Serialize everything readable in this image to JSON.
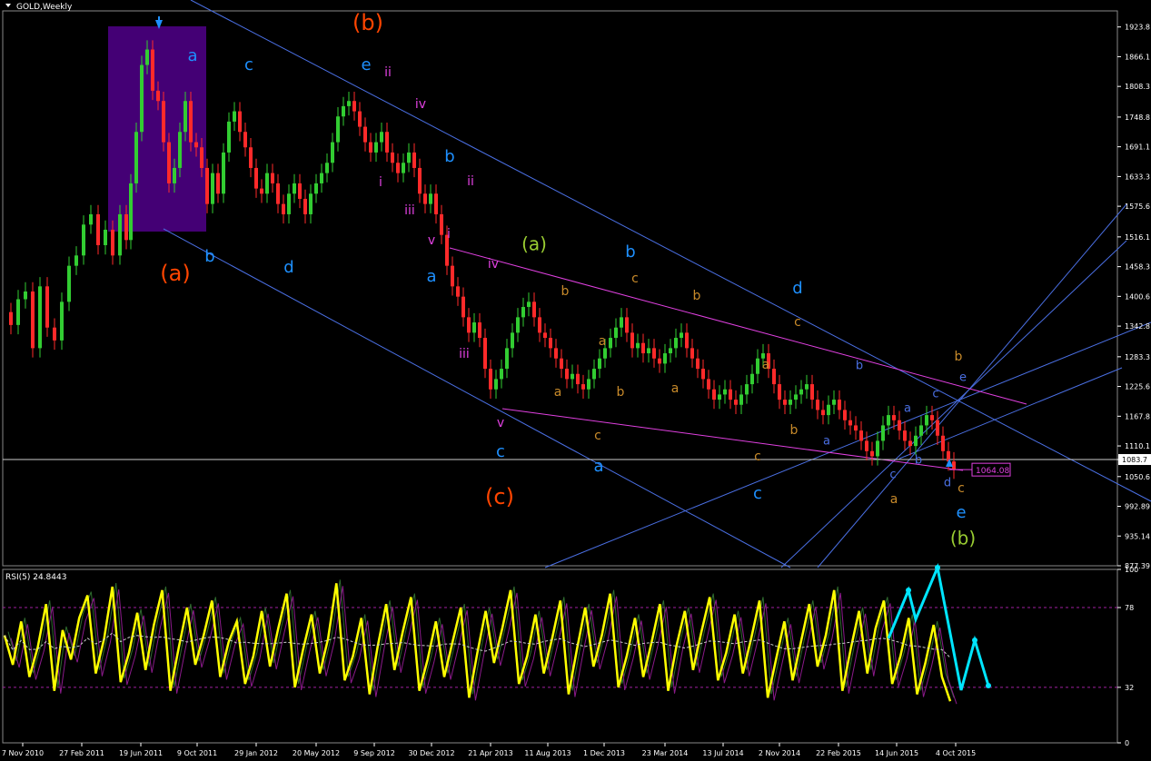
{
  "header": {
    "symbol_title": "GOLD,Weekly"
  },
  "colors": {
    "bull": "#32CD32",
    "bear": "#FF2A2A",
    "grid_line": "#FFFFFF",
    "channel": "#4A6FE3",
    "magenta": "#E040E0",
    "panel_border": "#FFFFFF",
    "rsi": "#FFFF00",
    "cyan_arrow": "#00E5FF",
    "price_tag_border": "#E040E0"
  },
  "chart_data": [
    {
      "type": "candlestick",
      "title": "GOLD,Weekly",
      "x_ticks": [
        "7 Nov 2010",
        "27 Feb 2011",
        "19 Jun 2011",
        "9 Oct 2011",
        "29 Jan 2012",
        "20 May 2012",
        "9 Sep 2012",
        "30 Dec 2012",
        "21 Apr 2013",
        "11 Aug 2013",
        "1 Dec 2013",
        "23 Mar 2014",
        "13 Jul 2014",
        "2 Nov 2014",
        "22 Feb 2015",
        "14 Jun 2015",
        "4 Oct 2015"
      ],
      "y_ticks": [
        1923.8,
        1866.1,
        1808.3,
        1748.8,
        1691.1,
        1633.3,
        1575.6,
        1516.1,
        1458.3,
        1400.6,
        1342.8,
        1283.3,
        1225.6,
        1167.8,
        1110.1,
        1083.7,
        1050.6,
        992.89,
        935.14,
        877.39
      ],
      "ylim": [
        877.39,
        1955
      ],
      "current_price": "1083.7",
      "price_tag": "1064.08",
      "close_path": [
        [
          0,
          1370
        ],
        [
          8,
          1345
        ],
        [
          16,
          1395
        ],
        [
          24,
          1410
        ],
        [
          32,
          1300
        ],
        [
          40,
          1420
        ],
        [
          48,
          1340
        ],
        [
          56,
          1315
        ],
        [
          64,
          1390
        ],
        [
          72,
          1460
        ],
        [
          80,
          1480
        ],
        [
          88,
          1540
        ],
        [
          96,
          1560
        ],
        [
          104,
          1500
        ],
        [
          112,
          1530
        ],
        [
          120,
          1480
        ],
        [
          128,
          1560
        ],
        [
          135,
          1510
        ],
        [
          140,
          1620
        ],
        [
          146,
          1720
        ],
        [
          152,
          1850
        ],
        [
          158,
          1880
        ],
        [
          164,
          1800
        ],
        [
          170,
          1780
        ],
        [
          176,
          1700
        ],
        [
          182,
          1620
        ],
        [
          188,
          1650
        ],
        [
          194,
          1720
        ],
        [
          200,
          1780
        ],
        [
          206,
          1700
        ],
        [
          212,
          1690
        ],
        [
          218,
          1650
        ],
        [
          224,
          1580
        ],
        [
          230,
          1640
        ],
        [
          236,
          1600
        ],
        [
          242,
          1680
        ],
        [
          248,
          1740
        ],
        [
          254,
          1760
        ],
        [
          260,
          1720
        ],
        [
          266,
          1690
        ],
        [
          272,
          1650
        ],
        [
          278,
          1610
        ],
        [
          284,
          1600
        ],
        [
          290,
          1640
        ],
        [
          296,
          1620
        ],
        [
          302,
          1580
        ],
        [
          308,
          1560
        ],
        [
          314,
          1600
        ],
        [
          320,
          1620
        ],
        [
          326,
          1590
        ],
        [
          332,
          1560
        ],
        [
          338,
          1600
        ],
        [
          344,
          1620
        ],
        [
          350,
          1640
        ],
        [
          356,
          1660
        ],
        [
          362,
          1700
        ],
        [
          368,
          1750
        ],
        [
          374,
          1770
        ],
        [
          380,
          1780
        ],
        [
          386,
          1760
        ],
        [
          392,
          1730
        ],
        [
          398,
          1700
        ],
        [
          404,
          1680
        ],
        [
          410,
          1700
        ],
        [
          416,
          1720
        ],
        [
          422,
          1680
        ],
        [
          428,
          1660
        ],
        [
          434,
          1640
        ],
        [
          440,
          1660
        ],
        [
          446,
          1680
        ],
        [
          452,
          1650
        ],
        [
          458,
          1600
        ],
        [
          464,
          1580
        ],
        [
          470,
          1600
        ],
        [
          476,
          1560
        ],
        [
          482,
          1520
        ],
        [
          488,
          1460
        ],
        [
          494,
          1420
        ],
        [
          500,
          1400
        ],
        [
          506,
          1360
        ],
        [
          512,
          1330
        ],
        [
          518,
          1350
        ],
        [
          524,
          1320
        ],
        [
          530,
          1260
        ],
        [
          536,
          1220
        ],
        [
          542,
          1240
        ],
        [
          548,
          1260
        ],
        [
          554,
          1300
        ],
        [
          560,
          1330
        ],
        [
          566,
          1360
        ],
        [
          572,
          1380
        ],
        [
          578,
          1390
        ],
        [
          584,
          1360
        ],
        [
          590,
          1330
        ],
        [
          596,
          1320
        ],
        [
          602,
          1300
        ],
        [
          608,
          1280
        ],
        [
          614,
          1260
        ],
        [
          620,
          1240
        ],
        [
          626,
          1250
        ],
        [
          632,
          1230
        ],
        [
          638,
          1220
        ],
        [
          644,
          1240
        ],
        [
          650,
          1260
        ],
        [
          656,
          1280
        ],
        [
          662,
          1300
        ],
        [
          668,
          1320
        ],
        [
          674,
          1340
        ],
        [
          680,
          1360
        ],
        [
          686,
          1330
        ],
        [
          692,
          1300
        ],
        [
          698,
          1310
        ],
        [
          704,
          1290
        ],
        [
          710,
          1300
        ],
        [
          716,
          1280
        ],
        [
          722,
          1270
        ],
        [
          728,
          1290
        ],
        [
          734,
          1300
        ],
        [
          740,
          1320
        ],
        [
          746,
          1330
        ],
        [
          752,
          1300
        ],
        [
          758,
          1280
        ],
        [
          764,
          1260
        ],
        [
          770,
          1240
        ],
        [
          776,
          1220
        ],
        [
          782,
          1200
        ],
        [
          788,
          1210
        ],
        [
          794,
          1220
        ],
        [
          800,
          1200
        ],
        [
          806,
          1190
        ],
        [
          812,
          1210
        ],
        [
          818,
          1230
        ],
        [
          824,
          1250
        ],
        [
          830,
          1280
        ],
        [
          836,
          1290
        ],
        [
          842,
          1260
        ],
        [
          848,
          1230
        ],
        [
          854,
          1200
        ],
        [
          860,
          1190
        ],
        [
          866,
          1200
        ],
        [
          872,
          1210
        ],
        [
          878,
          1220
        ],
        [
          884,
          1230
        ],
        [
          890,
          1200
        ],
        [
          896,
          1180
        ],
        [
          902,
          1170
        ],
        [
          908,
          1190
        ],
        [
          914,
          1200
        ],
        [
          920,
          1180
        ],
        [
          926,
          1160
        ],
        [
          932,
          1150
        ],
        [
          938,
          1140
        ],
        [
          944,
          1120
        ],
        [
          950,
          1100
        ],
        [
          956,
          1090
        ],
        [
          962,
          1120
        ],
        [
          968,
          1150
        ],
        [
          974,
          1170
        ],
        [
          980,
          1160
        ],
        [
          986,
          1140
        ],
        [
          992,
          1120
        ],
        [
          998,
          1110
        ],
        [
          1004,
          1130
        ],
        [
          1010,
          1150
        ],
        [
          1016,
          1170
        ],
        [
          1022,
          1160
        ],
        [
          1028,
          1130
        ],
        [
          1034,
          1100
        ],
        [
          1040,
          1080
        ],
        [
          1046,
          1064
        ]
      ]
    },
    {
      "type": "line",
      "title": "RSI(5) 24.8443",
      "y_ticks": [
        100,
        78,
        32,
        0
      ],
      "ylim": [
        0,
        100
      ],
      "series": [
        {
          "name": "RSI(5)",
          "values": [
            62,
            45,
            70,
            38,
            55,
            80,
            30,
            65,
            48,
            72,
            85,
            40,
            60,
            90,
            35,
            52,
            75,
            42,
            68,
            88,
            30,
            55,
            78,
            45,
            62,
            82,
            38,
            58,
            70,
            34,
            50,
            76,
            44,
            66,
            86,
            32,
            54,
            74,
            40,
            60,
            92,
            36,
            50,
            72,
            28,
            56,
            80,
            42,
            64,
            84,
            30,
            48,
            70,
            38,
            58,
            78,
            26,
            52,
            76,
            46,
            66,
            88,
            34,
            50,
            74,
            40,
            60,
            82,
            28,
            54,
            78,
            44,
            62,
            86,
            32,
            50,
            72,
            38,
            58,
            80,
            30,
            56,
            76,
            42,
            64,
            84,
            36,
            52,
            74,
            40,
            60,
            82,
            26,
            48,
            70,
            36,
            58,
            80,
            44,
            62,
            88,
            30,
            54,
            76,
            40,
            66,
            82,
            34,
            50,
            72,
            28,
            46,
            68,
            38,
            24
          ]
        }
      ]
    }
  ],
  "wave_labels": [
    {
      "text": "(b)",
      "x": 405,
      "y": 26,
      "color": "#FF4500",
      "size": 24
    },
    {
      "text": "(a)",
      "x": 193,
      "y": 302,
      "color": "#FF4500",
      "size": 24
    },
    {
      "text": "(c)",
      "x": 550,
      "y": 548,
      "color": "#FF4500",
      "size": 24
    },
    {
      "text": "(a)",
      "x": 588,
      "y": 270,
      "color": "#9ACD32",
      "size": 20
    },
    {
      "text": "(b)",
      "x": 1060,
      "y": 594,
      "color": "#9ACD32",
      "size": 20
    },
    {
      "text": "a",
      "x": 212,
      "y": 62,
      "color": "#1E90FF",
      "size": 18
    },
    {
      "text": "c",
      "x": 274,
      "y": 72,
      "color": "#1E90FF",
      "size": 18
    },
    {
      "text": "e",
      "x": 403,
      "y": 72,
      "color": "#1E90FF",
      "size": 18
    },
    {
      "text": "b",
      "x": 231,
      "y": 283,
      "color": "#1E90FF",
      "size": 18
    },
    {
      "text": "d",
      "x": 318,
      "y": 295,
      "color": "#1E90FF",
      "size": 18
    },
    {
      "text": "b",
      "x": 495,
      "y": 173,
      "color": "#1E90FF",
      "size": 18
    },
    {
      "text": "a",
      "x": 475,
      "y": 305,
      "color": "#1E90FF",
      "size": 18
    },
    {
      "text": "c",
      "x": 551,
      "y": 498,
      "color": "#1E90FF",
      "size": 18
    },
    {
      "text": "a",
      "x": 659,
      "y": 514,
      "color": "#1E90FF",
      "size": 18
    },
    {
      "text": "b",
      "x": 694,
      "y": 278,
      "color": "#1E90FF",
      "size": 18
    },
    {
      "text": "d",
      "x": 878,
      "y": 318,
      "color": "#1E90FF",
      "size": 18
    },
    {
      "text": "c",
      "x": 834,
      "y": 544,
      "color": "#1E90FF",
      "size": 18
    },
    {
      "text": "e",
      "x": 1058,
      "y": 565,
      "color": "#1E90FF",
      "size": 18
    },
    {
      "text": "ii",
      "x": 427,
      "y": 80,
      "color": "#E040E0",
      "size": 14
    },
    {
      "text": "iv",
      "x": 463,
      "y": 115,
      "color": "#E040E0",
      "size": 14
    },
    {
      "text": "i",
      "x": 419,
      "y": 201,
      "color": "#E040E0",
      "size": 14
    },
    {
      "text": "iii",
      "x": 451,
      "y": 232,
      "color": "#E040E0",
      "size": 14
    },
    {
      "text": "ii",
      "x": 518,
      "y": 200,
      "color": "#E040E0",
      "size": 14
    },
    {
      "text": "i",
      "x": 494,
      "y": 258,
      "color": "#E040E0",
      "size": 14
    },
    {
      "text": "v",
      "x": 475,
      "y": 265,
      "color": "#E040E0",
      "size": 14
    },
    {
      "text": "iv",
      "x": 543,
      "y": 291,
      "color": "#E040E0",
      "size": 14
    },
    {
      "text": "iii",
      "x": 511,
      "y": 390,
      "color": "#E040E0",
      "size": 14
    },
    {
      "text": "v",
      "x": 551,
      "y": 466,
      "color": "#E040E0",
      "size": 14
    },
    {
      "text": "b",
      "x": 622,
      "y": 321,
      "color": "#C88A2A",
      "size": 14
    },
    {
      "text": "c",
      "x": 699,
      "y": 307,
      "color": "#C88A2A",
      "size": 14
    },
    {
      "text": "b",
      "x": 767,
      "y": 326,
      "color": "#C88A2A",
      "size": 14
    },
    {
      "text": "c",
      "x": 878,
      "y": 355,
      "color": "#C88A2A",
      "size": 14
    },
    {
      "text": "a",
      "x": 663,
      "y": 376,
      "color": "#C88A2A",
      "size": 14
    },
    {
      "text": "a",
      "x": 614,
      "y": 432,
      "color": "#C88A2A",
      "size": 14
    },
    {
      "text": "b",
      "x": 683,
      "y": 432,
      "color": "#C88A2A",
      "size": 14
    },
    {
      "text": "a",
      "x": 743,
      "y": 428,
      "color": "#C88A2A",
      "size": 14
    },
    {
      "text": "a",
      "x": 843,
      "y": 402,
      "color": "#C88A2A",
      "size": 14
    },
    {
      "text": "b",
      "x": 874,
      "y": 474,
      "color": "#C88A2A",
      "size": 14
    },
    {
      "text": "c",
      "x": 658,
      "y": 480,
      "color": "#C88A2A",
      "size": 14
    },
    {
      "text": "c",
      "x": 834,
      "y": 503,
      "color": "#C88A2A",
      "size": 14
    },
    {
      "text": "b",
      "x": 1055,
      "y": 393,
      "color": "#C88A2A",
      "size": 14
    },
    {
      "text": "a",
      "x": 984,
      "y": 550,
      "color": "#C88A2A",
      "size": 14
    },
    {
      "text": "c",
      "x": 1058,
      "y": 538,
      "color": "#C88A2A",
      "size": 14
    },
    {
      "text": "b",
      "x": 946,
      "y": 403,
      "color": "#4A6FE3",
      "size": 13
    },
    {
      "text": "a",
      "x": 910,
      "y": 486,
      "color": "#4A6FE3",
      "size": 13
    },
    {
      "text": "a",
      "x": 999,
      "y": 450,
      "color": "#4A6FE3",
      "size": 13
    },
    {
      "text": "c",
      "x": 1030,
      "y": 434,
      "color": "#4A6FE3",
      "size": 13
    },
    {
      "text": "e",
      "x": 1060,
      "y": 416,
      "color": "#4A6FE3",
      "size": 13
    },
    {
      "text": "b",
      "x": 1011,
      "y": 507,
      "color": "#4A6FE3",
      "size": 13
    },
    {
      "text": "c",
      "x": 983,
      "y": 523,
      "color": "#4A6FE3",
      "size": 13
    },
    {
      "text": "d",
      "x": 1043,
      "y": 532,
      "color": "#4A6FE3",
      "size": 13
    }
  ]
}
